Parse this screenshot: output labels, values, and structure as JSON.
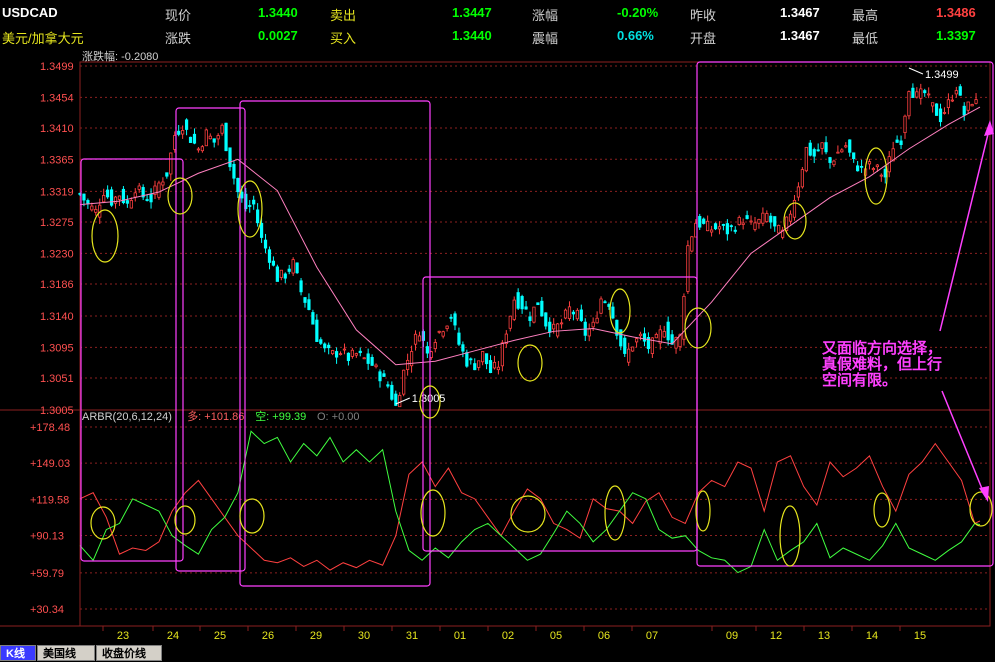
{
  "header": {
    "row1": [
      {
        "label": "USDCAD",
        "cls": "sym"
      },
      {
        "label": "现价",
        "cls": "lbl"
      },
      {
        "label": "1.3440",
        "cls": "dn"
      },
      {
        "label": "卖出",
        "cls": "ylbl"
      },
      {
        "label": "1.3447",
        "cls": "dn"
      },
      {
        "label": "涨幅",
        "cls": "lbl"
      },
      {
        "label": "-0.20%",
        "cls": "dn"
      },
      {
        "label": "昨收",
        "cls": "lbl"
      },
      {
        "label": "1.3467",
        "cls": "wh"
      },
      {
        "label": "最高",
        "cls": "lbl"
      },
      {
        "label": "1.3486",
        "cls": "up"
      }
    ],
    "row2": [
      {
        "label": "美元/加拿大元",
        "cls": "ylbl"
      },
      {
        "label": "涨跌",
        "cls": "lbl"
      },
      {
        "label": "0.0027",
        "cls": "dn"
      },
      {
        "label": "买入",
        "cls": "ylbl"
      },
      {
        "label": "1.3440",
        "cls": "dn"
      },
      {
        "label": "震幅",
        "cls": "lbl"
      },
      {
        "label": "0.66%",
        "cls": "cy"
      },
      {
        "label": "开盘",
        "cls": "lbl"
      },
      {
        "label": "1.3467",
        "cls": "wh"
      },
      {
        "label": "最低",
        "cls": "lbl"
      },
      {
        "label": "1.3397",
        "cls": "dn"
      }
    ]
  },
  "chart_data": {
    "type": "candlestick",
    "price_panel": {
      "range_label": "涨跌幅: -0.2080",
      "yticks": [
        "1.3499",
        "1.3454",
        "1.3410",
        "1.3365",
        "1.3319",
        "1.3275",
        "1.3230",
        "1.3186",
        "1.3140",
        "1.3095",
        "1.3051",
        "1.3005"
      ],
      "ylim": [
        1.3005,
        1.3499
      ],
      "annotations": [
        {
          "text": "1.3499",
          "kind": "high"
        },
        {
          "text": "1.3005",
          "kind": "low"
        }
      ],
      "close_path": [
        [
          0,
          1.3315
        ],
        [
          6,
          1.33
        ],
        [
          12,
          1.329
        ],
        [
          18,
          1.332
        ],
        [
          24,
          1.3305
        ],
        [
          30,
          1.3315
        ],
        [
          36,
          1.33
        ],
        [
          42,
          1.3325
        ],
        [
          48,
          1.3312
        ],
        [
          54,
          1.3308
        ],
        [
          60,
          1.333
        ],
        [
          66,
          1.3345
        ],
        [
          72,
          1.34
        ],
        [
          78,
          1.3415
        ],
        [
          84,
          1.3395
        ],
        [
          90,
          1.338
        ],
        [
          96,
          1.3402
        ],
        [
          102,
          1.339
        ],
        [
          108,
          1.341
        ],
        [
          114,
          1.336
        ],
        [
          120,
          1.3318
        ],
        [
          126,
          1.3295
        ],
        [
          132,
          1.33
        ],
        [
          138,
          1.325
        ],
        [
          144,
          1.3225
        ],
        [
          150,
          1.3195
        ],
        [
          156,
          1.32
        ],
        [
          162,
          1.3215
        ],
        [
          168,
          1.3175
        ],
        [
          174,
          1.315
        ],
        [
          180,
          1.311
        ],
        [
          186,
          1.309
        ],
        [
          192,
          1.3085
        ],
        [
          198,
          1.309
        ],
        [
          204,
          1.308
        ],
        [
          210,
          1.3085
        ],
        [
          216,
          1.3078
        ],
        [
          222,
          1.307
        ],
        [
          228,
          1.3055
        ],
        [
          234,
          1.304
        ],
        [
          240,
          1.301
        ],
        [
          246,
          1.306
        ],
        [
          252,
          1.3095
        ],
        [
          258,
          1.312
        ],
        [
          264,
          1.3085
        ],
        [
          270,
          1.311
        ],
        [
          276,
          1.3125
        ],
        [
          282,
          1.314
        ],
        [
          288,
          1.31
        ],
        [
          294,
          1.3075
        ],
        [
          300,
          1.307
        ],
        [
          306,
          1.3085
        ],
        [
          312,
          1.306
        ],
        [
          318,
          1.307
        ],
        [
          324,
          1.312
        ],
        [
          330,
          1.3165
        ],
        [
          336,
          1.3155
        ],
        [
          342,
          1.314
        ],
        [
          348,
          1.316
        ],
        [
          354,
          1.313
        ],
        [
          360,
          1.312
        ],
        [
          366,
          1.313
        ],
        [
          372,
          1.315
        ],
        [
          378,
          1.314
        ],
        [
          384,
          1.3115
        ],
        [
          390,
          1.3125
        ],
        [
          396,
          1.3165
        ],
        [
          402,
          1.316
        ],
        [
          408,
          1.312
        ],
        [
          414,
          1.308
        ],
        [
          420,
          1.31
        ],
        [
          426,
          1.311
        ],
        [
          432,
          1.3095
        ],
        [
          438,
          1.3105
        ],
        [
          444,
          1.3125
        ],
        [
          450,
          1.31
        ],
        [
          456,
          1.311
        ],
        [
          462,
          1.324
        ],
        [
          468,
          1.3275
        ],
        [
          474,
          1.327
        ],
        [
          480,
          1.3265
        ],
        [
          486,
          1.3268
        ],
        [
          492,
          1.3262
        ],
        [
          498,
          1.327
        ],
        [
          504,
          1.328
        ],
        [
          510,
          1.327
        ],
        [
          516,
          1.3275
        ],
        [
          522,
          1.3285
        ],
        [
          528,
          1.3265
        ],
        [
          534,
          1.3258
        ],
        [
          540,
          1.329
        ],
        [
          546,
          1.333
        ],
        [
          552,
          1.338
        ],
        [
          558,
          1.337
        ],
        [
          564,
          1.3385
        ],
        [
          570,
          1.336
        ],
        [
          576,
          1.3375
        ],
        [
          582,
          1.3385
        ],
        [
          588,
          1.336
        ],
        [
          594,
          1.335
        ],
        [
          600,
          1.3355
        ],
        [
          606,
          1.335
        ],
        [
          612,
          1.334
        ],
        [
          618,
          1.3385
        ],
        [
          624,
          1.3395
        ],
        [
          630,
          1.347
        ],
        [
          636,
          1.3455
        ],
        [
          642,
          1.346
        ],
        [
          648,
          1.344
        ],
        [
          654,
          1.3425
        ],
        [
          660,
          1.3445
        ],
        [
          666,
          1.347
        ],
        [
          672,
          1.343
        ],
        [
          678,
          1.345
        ],
        [
          684,
          1.344
        ]
      ],
      "ma_path": [
        [
          0,
          1.33
        ],
        [
          30,
          1.3305
        ],
        [
          60,
          1.3318
        ],
        [
          90,
          1.3345
        ],
        [
          120,
          1.3365
        ],
        [
          150,
          1.332
        ],
        [
          180,
          1.321
        ],
        [
          210,
          1.312
        ],
        [
          240,
          1.307
        ],
        [
          270,
          1.3075
        ],
        [
          300,
          1.309
        ],
        [
          330,
          1.3105
        ],
        [
          360,
          1.3118
        ],
        [
          390,
          1.3122
        ],
        [
          420,
          1.311
        ],
        [
          450,
          1.31
        ],
        [
          480,
          1.316
        ],
        [
          510,
          1.323
        ],
        [
          540,
          1.327
        ],
        [
          570,
          1.331
        ],
        [
          600,
          1.334
        ],
        [
          630,
          1.338
        ],
        [
          660,
          1.3415
        ],
        [
          684,
          1.344
        ]
      ]
    },
    "indicator_panel": {
      "legend": [
        {
          "text": "ARBR(20,6,12,24)",
          "color": "#d0d0d0"
        },
        {
          "text": "多: +101.86",
          "color": "#ff6060"
        },
        {
          "text": "空: +99.39",
          "color": "#40ff40"
        },
        {
          "text": "O: +0.00",
          "color": "#808080"
        }
      ],
      "yticks": [
        "+178.48",
        "+149.03",
        "+119.58",
        "+90.13",
        "+59.79",
        "+30.34"
      ],
      "ylim": [
        30.34,
        178.48
      ],
      "ar_path": [
        [
          0,
          120
        ],
        [
          10,
          125
        ],
        [
          20,
          105
        ],
        [
          30,
          75
        ],
        [
          40,
          80
        ],
        [
          50,
          78
        ],
        [
          60,
          85
        ],
        [
          70,
          110
        ],
        [
          80,
          125
        ],
        [
          90,
          135
        ],
        [
          100,
          120
        ],
        [
          110,
          105
        ],
        [
          120,
          90
        ],
        [
          130,
          80
        ],
        [
          140,
          70
        ],
        [
          150,
          68
        ],
        [
          160,
          72
        ],
        [
          170,
          65
        ],
        [
          180,
          70
        ],
        [
          190,
          62
        ],
        [
          200,
          68
        ],
        [
          210,
          64
        ],
        [
          220,
          70
        ],
        [
          230,
          66
        ],
        [
          240,
          90
        ],
        [
          250,
          140
        ],
        [
          260,
          150
        ],
        [
          270,
          130
        ],
        [
          280,
          145
        ],
        [
          290,
          125
        ],
        [
          300,
          120
        ],
        [
          310,
          105
        ],
        [
          320,
          90
        ],
        [
          330,
          110
        ],
        [
          340,
          128
        ],
        [
          350,
          120
        ],
        [
          360,
          100
        ],
        [
          370,
          95
        ],
        [
          380,
          88
        ],
        [
          390,
          120
        ],
        [
          400,
          112
        ],
        [
          410,
          110
        ],
        [
          420,
          100
        ],
        [
          430,
          118
        ],
        [
          440,
          125
        ],
        [
          450,
          105
        ],
        [
          460,
          100
        ],
        [
          470,
          125
        ],
        [
          480,
          135
        ],
        [
          490,
          130
        ],
        [
          500,
          150
        ],
        [
          510,
          145
        ],
        [
          520,
          110
        ],
        [
          530,
          150
        ],
        [
          540,
          155
        ],
        [
          550,
          130
        ],
        [
          560,
          115
        ],
        [
          570,
          150
        ],
        [
          580,
          138
        ],
        [
          590,
          145
        ],
        [
          600,
          155
        ],
        [
          610,
          130
        ],
        [
          620,
          110
        ],
        [
          630,
          140
        ],
        [
          640,
          150
        ],
        [
          650,
          165
        ],
        [
          660,
          150
        ],
        [
          670,
          135
        ],
        [
          680,
          100
        ],
        [
          684,
          102
        ]
      ],
      "br_path": [
        [
          0,
          82
        ],
        [
          10,
          70
        ],
        [
          20,
          95
        ],
        [
          30,
          100
        ],
        [
          40,
          120
        ],
        [
          50,
          115
        ],
        [
          60,
          110
        ],
        [
          70,
          90
        ],
        [
          80,
          82
        ],
        [
          90,
          75
        ],
        [
          100,
          95
        ],
        [
          110,
          105
        ],
        [
          120,
          125
        ],
        [
          130,
          175
        ],
        [
          140,
          165
        ],
        [
          150,
          170
        ],
        [
          160,
          150
        ],
        [
          170,
          165
        ],
        [
          180,
          155
        ],
        [
          190,
          170
        ],
        [
          200,
          150
        ],
        [
          210,
          160
        ],
        [
          220,
          150
        ],
        [
          230,
          160
        ],
        [
          240,
          110
        ],
        [
          250,
          78
        ],
        [
          260,
          70
        ],
        [
          270,
          80
        ],
        [
          280,
          72
        ],
        [
          290,
          85
        ],
        [
          300,
          95
        ],
        [
          310,
          100
        ],
        [
          320,
          90
        ],
        [
          330,
          80
        ],
        [
          340,
          70
        ],
        [
          350,
          75
        ],
        [
          360,
          92
        ],
        [
          370,
          110
        ],
        [
          380,
          100
        ],
        [
          390,
          85
        ],
        [
          400,
          95
        ],
        [
          410,
          110
        ],
        [
          420,
          125
        ],
        [
          430,
          120
        ],
        [
          440,
          95
        ],
        [
          450,
          88
        ],
        [
          460,
          90
        ],
        [
          470,
          78
        ],
        [
          480,
          72
        ],
        [
          490,
          70
        ],
        [
          500,
          60
        ],
        [
          510,
          65
        ],
        [
          520,
          95
        ],
        [
          530,
          70
        ],
        [
          540,
          78
        ],
        [
          550,
          85
        ],
        [
          560,
          100
        ],
        [
          570,
          72
        ],
        [
          580,
          80
        ],
        [
          590,
          75
        ],
        [
          600,
          70
        ],
        [
          610,
          82
        ],
        [
          620,
          100
        ],
        [
          630,
          80
        ],
        [
          640,
          75
        ],
        [
          650,
          70
        ],
        [
          660,
          78
        ],
        [
          670,
          85
        ],
        [
          680,
          100
        ],
        [
          684,
          99
        ]
      ]
    },
    "x_ticks": [
      "23",
      "24",
      "25",
      "26",
      "29",
      "30",
      "31",
      "01",
      "02",
      "05",
      "06",
      "07",
      "09",
      "12",
      "13",
      "14",
      "15"
    ],
    "grid": true
  },
  "annotation_note": [
    "又面临方向选择，",
    "真假难料，但上行",
    "空间有限。"
  ],
  "tabs": [
    {
      "label": "K线",
      "active": true
    },
    {
      "label": "美国线",
      "active": false
    },
    {
      "label": "收盘价线",
      "active": false
    }
  ],
  "colors": {
    "up": "#ff4040",
    "down": "#00ffff",
    "ma": "#ff80c0",
    "ar": "#ff4040",
    "br": "#40ff40",
    "box": "#ff40ff",
    "circle": "#e6e61e",
    "grid": "#8b2020"
  }
}
